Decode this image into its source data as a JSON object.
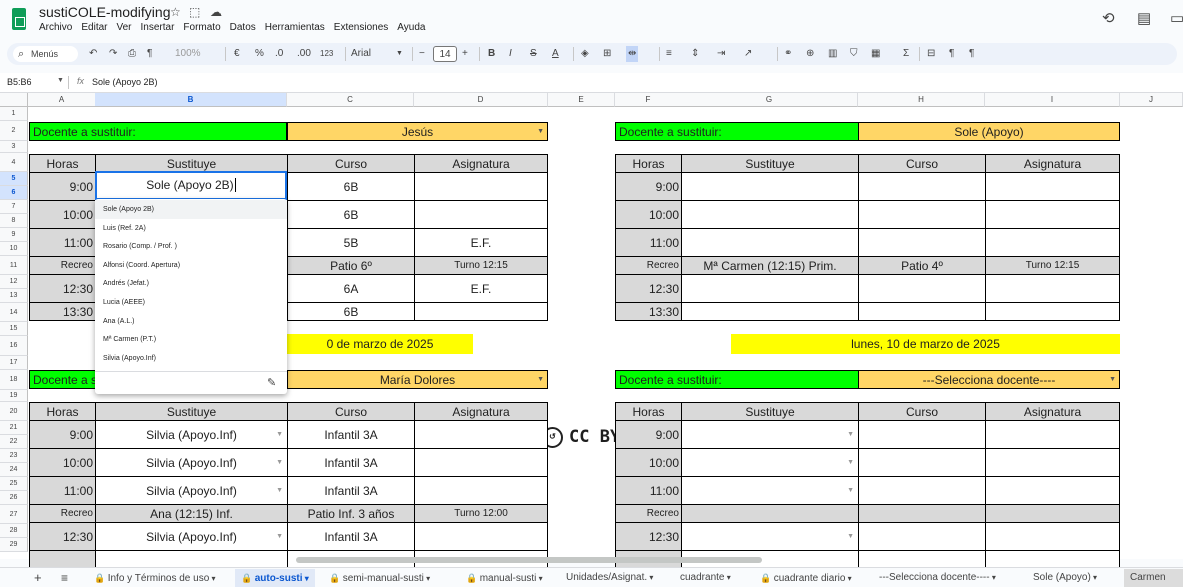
{
  "app": {
    "title": "sustiCOLE-modifying",
    "menus": [
      "Archivo",
      "Editar",
      "Ver",
      "Insertar",
      "Formato",
      "Datos",
      "Herramientas",
      "Extensiones",
      "Ayuda"
    ]
  },
  "toolbar": {
    "search": "Menús",
    "zoom": "100%",
    "currency": "€",
    "percent": "%",
    "dec_minus": ".0",
    "dec_plus": ".00",
    "format_num": "123",
    "font": "Arial",
    "font_size": "14"
  },
  "formula": {
    "cell_ref": "B5:B6",
    "fx": "fx",
    "value": "Sole (Apoyo 2B)"
  },
  "columns": [
    "A",
    "B",
    "C",
    "D",
    "E",
    "F",
    "G",
    "H",
    "I",
    "J"
  ],
  "rows": [
    "1",
    "2",
    "3",
    "4",
    "5",
    "6",
    "7",
    "8",
    "9",
    "10",
    "11",
    "12",
    "13",
    "14",
    "15",
    "16",
    "17",
    "18",
    "19",
    "20",
    "21",
    "22",
    "23",
    "24",
    "25",
    "26",
    "27",
    "28",
    "29"
  ],
  "labels": {
    "docente": "Docente a sustituir:",
    "horas": "Horas",
    "sustituye": "Sustituye",
    "curso": "Curso",
    "asignatura": "Asignatura",
    "recreo": "Recreo"
  },
  "times": [
    "9:00",
    "10:00",
    "11:00",
    "12:30",
    "13:30"
  ],
  "block1": {
    "teacher": "Jesús",
    "editing": "Sole (Apoyo 2B)",
    "cursos": [
      "6B",
      "6B",
      "5B",
      "Patio 6º",
      "6A",
      "6B"
    ],
    "asig": [
      "",
      "",
      "E.F.",
      "Turno 12:15",
      "E.F.",
      ""
    ]
  },
  "block2": {
    "teacher": "Sole (Apoyo)",
    "recreo_sust": "Mª Carmen (12:15) Prim.",
    "recreo_curso": "Patio 4º",
    "recreo_turno": "Turno 12:15"
  },
  "block3": {
    "teacher": "María Dolores",
    "short_label": "Docente a s",
    "sust": [
      "Silvia (Apoyo.Inf)",
      "Silvia (Apoyo.Inf)",
      "Silvia (Apoyo.Inf)",
      "Ana (12:15) Inf.",
      "Silvia (Apoyo.Inf)"
    ],
    "cursos": [
      "Infantil 3A",
      "Infantil 3A",
      "Infantil 3A",
      "Patio Inf. 3 años",
      "Infantil 3A"
    ],
    "recreo_turno": "Turno 12:00"
  },
  "block4": {
    "teacher": "---Selecciona docente----"
  },
  "dates": {
    "left": "0 de marzo de 2025",
    "right": "lunes, 10 de marzo de 2025"
  },
  "license": "CC BY-NC-SA 4.0",
  "dropdown": [
    "Sole (Apoyo 2B)",
    "Luis (Ref. 2A)",
    "Rosario (Comp. / Prof. )",
    "Alfonsi (Coord. Apertura)",
    "Andrés (Jefat.)",
    "Lucia (AEEE)",
    "Ana (A.L.)",
    "Mª Carmen (P.T.)",
    "Silvia (Apoyo.Inf)"
  ],
  "tabs": [
    "Info y Términos de uso",
    "auto-susti",
    "semi-manual-susti",
    "manual-susti",
    "Unidades/Asignat.",
    "cuadrante",
    "cuadrante diario",
    "---Selecciona docente----",
    "Sole (Apoyo)",
    "Carmen"
  ]
}
